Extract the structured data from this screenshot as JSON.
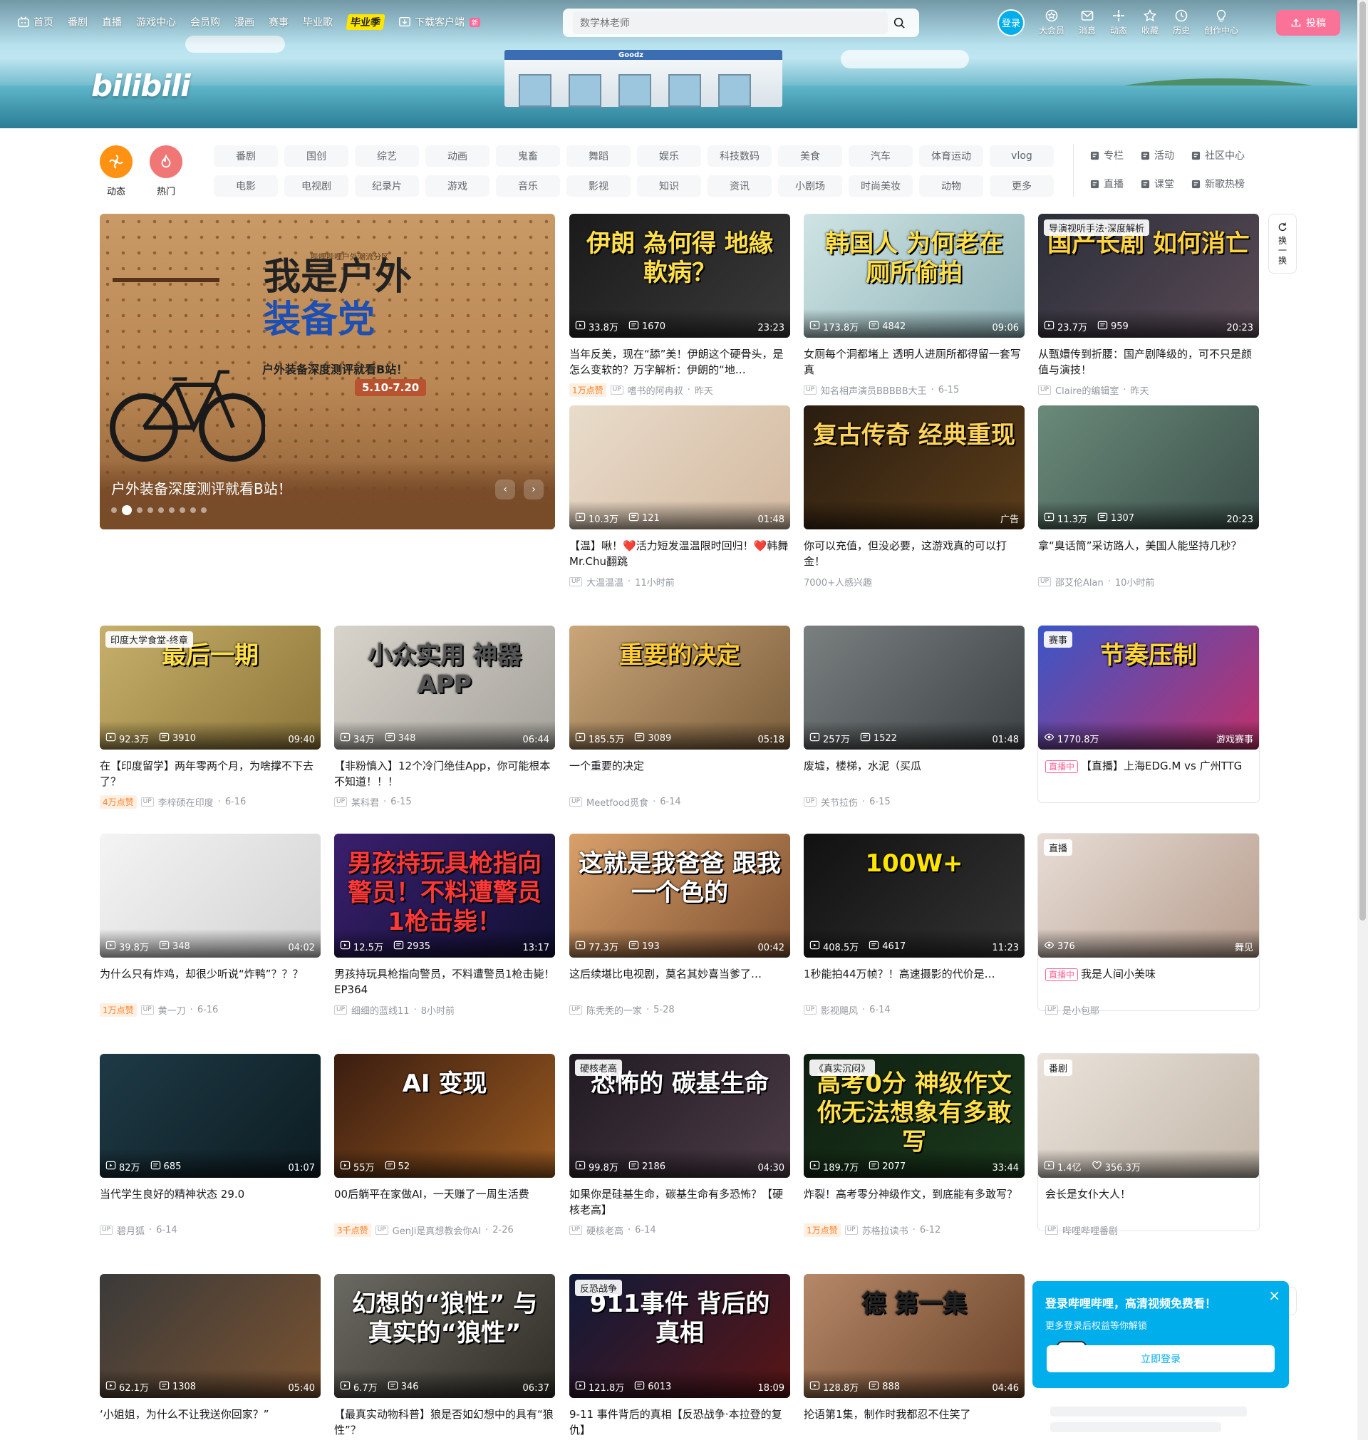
{
  "header": {
    "logo": "bilibili",
    "nav": [
      {
        "label": "首页",
        "icon": "tv-icon"
      },
      {
        "label": "番剧"
      },
      {
        "label": "直播"
      },
      {
        "label": "游戏中心"
      },
      {
        "label": "会员购"
      },
      {
        "label": "漫画"
      },
      {
        "label": "赛事"
      },
      {
        "label": "毕业歌"
      }
    ],
    "graduation_badge": "毕业季",
    "download": {
      "label": "下载客户端",
      "badge": "新"
    },
    "search_placeholder": "数学林老师",
    "login": "登录",
    "right_nav": [
      {
        "label": "大会员",
        "icon": "vip-icon"
      },
      {
        "label": "消息",
        "icon": "message-icon"
      },
      {
        "label": "动态",
        "icon": "dynamic-icon"
      },
      {
        "label": "收藏",
        "icon": "star-icon"
      },
      {
        "label": "历史",
        "icon": "clock-icon"
      },
      {
        "label": "创作中心",
        "icon": "lightbulb-icon"
      }
    ],
    "upload": "投稿",
    "banner_store_sign": "Goodz"
  },
  "channels": {
    "big": [
      {
        "label": "动态",
        "color": "#ff9212"
      },
      {
        "label": "热门",
        "color": "#f07775"
      }
    ],
    "pills": [
      "番剧",
      "国创",
      "综艺",
      "动画",
      "鬼畜",
      "舞蹈",
      "娱乐",
      "科技数码",
      "美食",
      "汽车",
      "体育运动",
      "vlog",
      "电影",
      "电视剧",
      "纪录片",
      "游戏",
      "音乐",
      "影视",
      "知识",
      "资讯",
      "小剧场",
      "时尚美妆",
      "动物",
      "更多"
    ],
    "side_links": [
      "专栏",
      "活动",
      "社区中心",
      "直播",
      "课堂",
      "新歌热榜"
    ]
  },
  "carousel": {
    "promo_top": "哔哩哔哩户外潮流分区",
    "title_line1": "我是户外",
    "title_line2": "装备党",
    "subtitle": "户外装备深度测评就看B站！",
    "date": "5.10-7.20",
    "caption": "户外装备深度测评就看B站！",
    "prev": "‹",
    "next": "›"
  },
  "refresh": {
    "label": "换一换"
  },
  "videos": [
    {
      "headline": "伊朗 為何得 地緣軟病？",
      "views": "33.8万",
      "danmaku": "1670",
      "duration": "23:23",
      "title": "当年反美，现在“舔”美！伊朗这个硬骨头，是怎么变软的？万字解析：伊朗的“地…",
      "likes": "1万点赞",
      "author": "嗜书的阿冉叔",
      "date": "昨天"
    },
    {
      "headline": "韩国人 为何老在 厕所偷拍",
      "views": "173.8万",
      "danmaku": "4842",
      "duration": "09:06",
      "title": "女厕每个洞都堵上 透明人进厕所都得留一套写真",
      "author": "知名相声演员BBBBB大王",
      "date": "6-15"
    },
    {
      "headline": "国产长剧 如何消亡",
      "tag": "导演视听手法·深度解析",
      "views": "23.7万",
      "danmaku": "959",
      "duration": "20:23",
      "title": "从甄嬛传到折腰：国产剧降级的，可不只是颜值与演技！",
      "author": "Claire的编辑室",
      "date": "昨天"
    },
    {
      "headline": "",
      "views": "10.3万",
      "danmaku": "121",
      "duration": "01:48",
      "title": "【温】啾！❤️活力短发温温限时回归！❤️韩舞Mr.Chu翻跳",
      "author": "大温温温",
      "date": "11小时前"
    },
    {
      "headline": "复古传奇 经典重现",
      "ad": "广告",
      "title": "你可以充值，但没必要，这游戏真的可以打金！",
      "interest": "7000+人感兴趣"
    },
    {
      "headline": "",
      "views": "11.3万",
      "danmaku": "1307",
      "duration": "20:23",
      "title": "拿“臭话筒”采访路人，美国人能坚持几秒？",
      "author": "邵艾伦Alan",
      "date": "10小时前"
    },
    {
      "headline": "最后一期",
      "tag": "印度大学食堂-终章",
      "views": "92.3万",
      "danmaku": "3910",
      "duration": "09:40",
      "title": "在【印度留学】两年零两个月，为啥撑不下去了？",
      "likes": "4万点赞",
      "author": "李梓硕在印度",
      "date": "6-16"
    },
    {
      "headline": "小众实用 神器APP",
      "views": "34万",
      "danmaku": "348",
      "duration": "06:44",
      "title": "【非粉慎入】12个冷门绝佳App，你可能根本不知道！！！",
      "author": "某科君",
      "date": "6-15"
    },
    {
      "headline": "重要的决定",
      "views": "185.5万",
      "danmaku": "3089",
      "duration": "05:18",
      "title": "一个重要的决定",
      "author": "Meetfood觅食",
      "date": "6-14"
    },
    {
      "headline": "",
      "views": "257万",
      "danmaku": "1522",
      "duration": "01:48",
      "title": "废墟，楼梯，水泥（买瓜",
      "author": "关节拉伤",
      "date": "6-15"
    },
    {
      "headline": "节奏压制",
      "tag": "赛事",
      "watching": "1770.8万",
      "category": "游戏赛事",
      "live": "直播中",
      "title": "【直播】上海EDG.M vs 广州TTG"
    },
    {
      "headline": "",
      "views": "39.8万",
      "danmaku": "348",
      "duration": "04:02",
      "title": "为什么只有炸鸡，却很少听说“炸鸭”？？？",
      "likes": "1万点赞",
      "author": "黄一刀",
      "date": "6-16"
    },
    {
      "headline": "男孩持玩具枪指向警员！不料遭警员1枪击毙！",
      "views": "12.5万",
      "danmaku": "2935",
      "duration": "13:17",
      "title": "男孩持玩具枪指向警员，不料遭警员1枪击毙！EP364",
      "author": "细细的蓝线11",
      "date": "8小时前"
    },
    {
      "headline": "这就是我爸爸 跟我一个色的",
      "views": "77.3万",
      "danmaku": "193",
      "duration": "00:42",
      "title": "这后续堪比电视剧，莫名其妙喜当爹了…",
      "author": "陈秃秃的一家",
      "date": "5-28"
    },
    {
      "headline": "100W+",
      "views": "408.5万",
      "danmaku": "4617",
      "duration": "11:23",
      "title": "1秒能拍44万帧？！高速摄影的代价是…",
      "author": "影视飓风",
      "date": "6-14"
    },
    {
      "headline": "",
      "tag": "直播",
      "watching": "376",
      "category": "舞见",
      "live": "直播中",
      "title": "我是人间小美味",
      "author": "是小包耶"
    },
    {
      "headline": "",
      "views": "82万",
      "danmaku": "685",
      "duration": "01:07",
      "title": "当代学生良好的精神状态 29.0",
      "author": "碧月狐",
      "date": "6-14"
    },
    {
      "headline": "AI 变现",
      "views": "55万",
      "danmaku": "52",
      "duration": "",
      "title": "00后躺平在家做AI，一天赚了一周生活费",
      "likes": "3千点赞",
      "author": "GenJi是真想教会你AI",
      "date": "2-26"
    },
    {
      "headline": "恐怖的 碳基生命",
      "tag": "硬核老高",
      "views": "99.8万",
      "danmaku": "2186",
      "duration": "04:30",
      "title": "如果你是硅基生命，碳基生命有多恐怖？【硬核老高】",
      "author": "硬核老高",
      "date": "6-14"
    },
    {
      "headline": "高考0分 神级作文 你无法想象有多敢写",
      "tag": "《真实沉闷》",
      "views": "189.7万",
      "danmaku": "2077",
      "duration": "33:44",
      "title": "炸裂！高考零分神级作文，到底能有多敢写？",
      "likes": "1万点赞",
      "author": "苏格拉读书",
      "date": "6-12"
    },
    {
      "headline": "",
      "tag": "番剧",
      "views": "1.4亿",
      "follows": "356.3万",
      "title": "会长是女仆大人！",
      "author": "哔哩哔哩番剧"
    },
    {
      "headline": "",
      "views": "62.1万",
      "danmaku": "1308",
      "duration": "05:40",
      "title": "‘小姐姐，为什么不让我送你回家？”"
    },
    {
      "headline": "幻想的“狼性” 与 真实的“狼性”",
      "views": "6.7万",
      "danmaku": "346",
      "duration": "06:37",
      "title": "【最真实动物科普】狼是否如幻想中的具有“狼性”？"
    },
    {
      "headline": "911事件 背后的 真相",
      "tag": "反恐战争",
      "views": "121.8万",
      "danmaku": "6013",
      "duration": "18:09",
      "title": "9-11 事件背后的真相【反恐战争·本拉登的复仇】"
    },
    {
      "headline": "德 第一集",
      "views": "128.8万",
      "danmaku": "888",
      "duration": "04:46",
      "title": "抡语第1集，制作时我都忍不住笑了"
    }
  ],
  "login_popup": {
    "title": "登录哔哩哔哩，高清视频免费看！",
    "subtitle": "更多登录后权益等你解锁",
    "button": "立即登录",
    "close": "×"
  },
  "colors": {
    "brand_pink": "#fb7299",
    "brand_blue": "#00aeec",
    "text": "#18191c",
    "muted": "#9499a0"
  }
}
